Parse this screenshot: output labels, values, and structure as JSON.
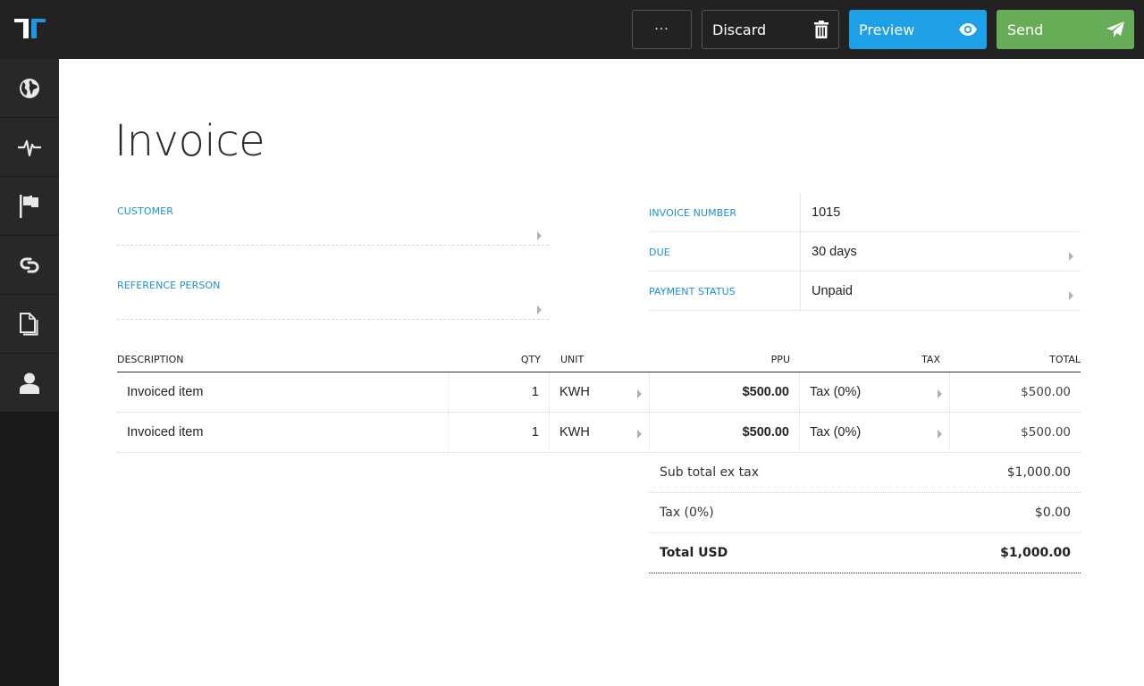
{
  "topbar": {
    "logo": "T-logo",
    "more_label": "···",
    "discard_label": "Discard",
    "preview_label": "Preview",
    "send_label": "Send",
    "colors": {
      "preview": "#1ea0e6",
      "send": "#67ad58",
      "accent": "#1e8fd6"
    }
  },
  "sidebar": {
    "items": [
      {
        "name": "globe",
        "icon": "globe-icon"
      },
      {
        "name": "activity",
        "icon": "pulse-icon"
      },
      {
        "name": "flag",
        "icon": "flag-icon"
      },
      {
        "name": "link",
        "icon": "link-icon"
      },
      {
        "name": "documents",
        "icon": "documents-icon"
      },
      {
        "name": "user",
        "icon": "user-icon"
      }
    ]
  },
  "page": {
    "title": "Invoice",
    "customer_label": "CUSTOMER",
    "customer_value": "",
    "reference_label": "REFERENCE PERSON",
    "reference_value": ""
  },
  "meta": [
    {
      "label": "INVOICE NUMBER",
      "value": "1015"
    },
    {
      "label": "DUE",
      "value": "30 days"
    },
    {
      "label": "PAYMENT STATUS",
      "value": "Unpaid"
    }
  ],
  "table": {
    "headers": {
      "description": "DESCRIPTION",
      "qty": "QTY",
      "unit": "UNIT",
      "ppu": "PPU",
      "tax": "TAX",
      "total": "TOTAL"
    },
    "rows": [
      {
        "description": "Invoiced item",
        "qty": "1",
        "unit": "KWH",
        "ppu": "$500.00",
        "tax": "Tax (0%)",
        "total": "$500.00"
      },
      {
        "description": "Invoiced item",
        "qty": "1",
        "unit": "KWH",
        "ppu": "$500.00",
        "tax": "Tax (0%)",
        "total": "$500.00"
      }
    ]
  },
  "totals": {
    "subtotal_label": "Sub total ex tax",
    "subtotal_value": "$1,000.00",
    "tax_label": "Tax (0%)",
    "tax_value": "$0.00",
    "total_label": "Total USD",
    "total_value": "$1,000.00"
  }
}
